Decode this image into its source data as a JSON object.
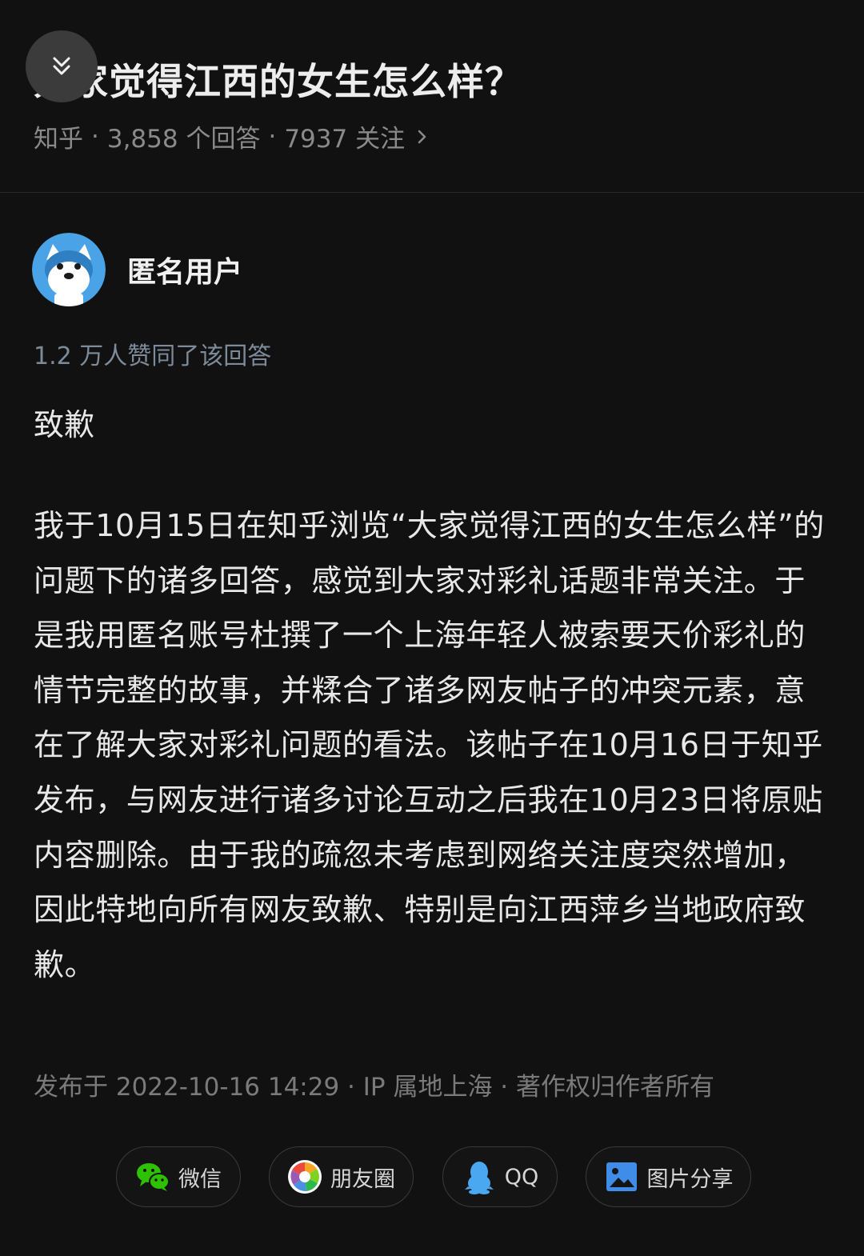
{
  "question": {
    "title": "大家觉得江西的女生怎么样？",
    "meta_source": "知乎",
    "meta_answers": "3,858 个回答",
    "meta_follows": "7937 关注"
  },
  "answer": {
    "author": "匿名用户",
    "votes": "1.2 万人赞同了该回答",
    "heading": "致歉",
    "body": "我于10月15日在知乎浏览“大家觉得江西的女生怎么样”的问题下的诸多回答，感觉到大家对彩礼话题非常关注。于是我用匿名账号杜撰了一个上海年轻人被索要天价彩礼的情节完整的故事，并糅合了诸多网友帖子的冲突元素，意在了解大家对彩礼问题的看法。该帖子在10月16日于知乎发布，与网友进行诸多讨论互动之后我在10月23日将原贴内容删除。由于我的疏忽未考虑到网络关注度突然增加，因此特地向所有网友致歉、特别是向江西萍乡当地政府致歉。",
    "published": "发布于 2022-10-16 14:29 · IP 属地上海 · 著作权归作者所有"
  },
  "share": {
    "wechat": "微信",
    "moments": "朋友圈",
    "qq": "QQ",
    "image": "图片分享"
  },
  "colors": {
    "background": "#111111",
    "wechat_green": "#2dc100",
    "qq_blue": "#4aa8f0",
    "image_blue": "#3f8de8",
    "avatar_blue": "#4aa3e6"
  }
}
